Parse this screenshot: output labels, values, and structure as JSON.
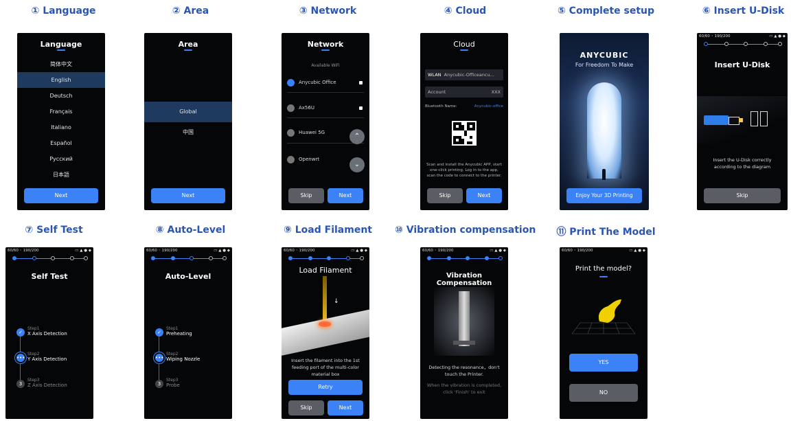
{
  "screens": {
    "language": {
      "title": "① Language",
      "header": "Language",
      "items": [
        "简体中文",
        "English",
        "Deutsch",
        "Français",
        "Italiano",
        "Español",
        "Русский",
        "日本語"
      ],
      "button": "Next"
    },
    "area": {
      "title": "② Area",
      "header": "Area",
      "items": [
        "Global",
        "中国"
      ],
      "button": "Next"
    },
    "network": {
      "title": "③ Network",
      "header": "Network",
      "subtitle": "Available WiFi",
      "wifi": [
        "Anycubic Office",
        "Ax56U",
        "Huawei 5G",
        "Openwrt"
      ],
      "skip": "Skip",
      "next": "Next"
    },
    "cloud": {
      "title": "④ Cloud",
      "header": "Cloud",
      "wlan_label": "WLAN",
      "wlan_value": "Anycubic-Officeancu...",
      "account_label": "Account",
      "account_value": "XXX",
      "bt_label": "Bluetooth Name:",
      "bt_value": "Anycubic-office",
      "desc": "Scan and install the Anycubic APP, start one-click printing. Log in to the app, scan the code to connect to the printer.",
      "skip": "Skip",
      "next": "Next"
    },
    "complete": {
      "title": "⑤ Complete setup",
      "brand": "ANYCUBIC",
      "tagline": "For Freedom To Make",
      "button": "Enjoy Your 3D Printing"
    },
    "udisk": {
      "title": "⑥ Insert U-Disk",
      "status_left": "60/60 ◦  190/200",
      "header": "Insert U-Disk",
      "desc": "Insert the U-Disk correctly according to the diagram",
      "button": "Skip"
    },
    "selftest": {
      "title": "⑦ Self Test",
      "status_left": "60/60 ◦  190/200",
      "header": "Self Test",
      "steps": [
        {
          "sub": "Step1",
          "main": "X Axis Detection"
        },
        {
          "sub": "Step2",
          "main": "Y Axis Detection"
        },
        {
          "sub": "Step3",
          "main": "Z Axis Detection"
        }
      ],
      "step3_num": "3"
    },
    "autolevel": {
      "title": "⑧ Auto-Level",
      "status_left": "60/60 ◦  190/200",
      "header": "Auto-Level",
      "steps": [
        {
          "sub": "Step1",
          "main": "Preheating"
        },
        {
          "sub": "Step2",
          "main": "Wiping Nozzle"
        },
        {
          "sub": "Step3",
          "main": "Probe"
        }
      ],
      "step3_num": "3"
    },
    "filament": {
      "title": "⑨ Load Filament",
      "status_left": "60/60 ◦  190/200",
      "header": "Load Filament",
      "desc": "Insert the filament into the 1st feeding port of the multi-color material box",
      "retry": "Retry",
      "skip": "Skip",
      "next": "Next"
    },
    "vibration": {
      "title": "⑩ Vibration compensation",
      "status_left": "60/60 ◦  190/200",
      "header": "Vibration Compensation",
      "desc1": "Detecting the resonance，don't touch the Printer.",
      "desc2": "When the vibration is completed, click 'Finish' to exit"
    },
    "printmodel": {
      "title": "⑪ Print The Model",
      "status_left": "60/60 ◦  190/200",
      "header": "Print the model?",
      "yes": "YES",
      "no": "NO"
    }
  },
  "colors": {
    "title_blue": "#2a55b5",
    "accent": "#3b82f6",
    "screen_bg": "#050608",
    "gray_button": "#5a5d63"
  }
}
